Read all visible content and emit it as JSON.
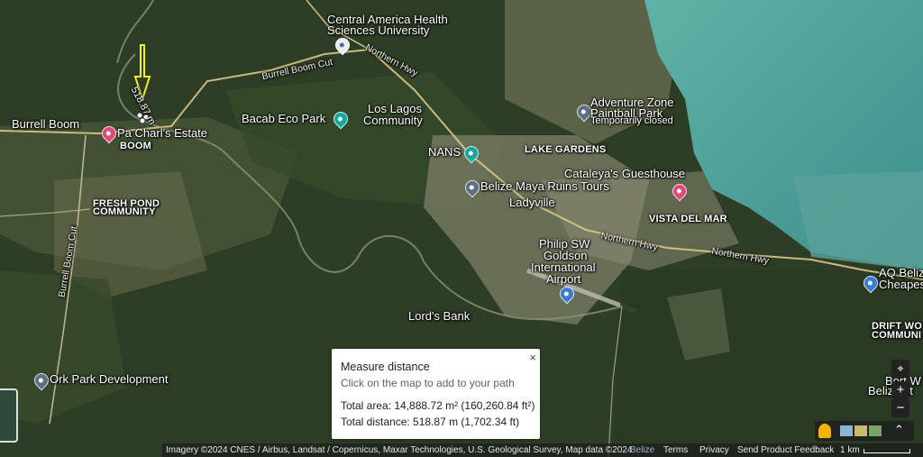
{
  "map": {
    "places": {
      "central_america_line1": "Central America Health",
      "central_america_line2": "Sciences University",
      "burrell_boom": "Burrell Boom",
      "pa_charls": "Pa Charl's Estate",
      "boom": "BOOM",
      "bacab": "Bacab Eco Park",
      "los_lagos_line1": "Los Lagos",
      "los_lagos_line2": "Community",
      "nans": "NANS",
      "adventure_line1": "Adventure Zone",
      "adventure_line2": "Paintball Park",
      "adventure_status": "Temporarily closed",
      "lake_gardens": "LAKE GARDENS",
      "cataleya": "Cataleya's Guesthouse",
      "belize_maya": "Belize Maya Ruins Tours",
      "ladyville": "Ladyville",
      "vista_del_mar": "VISTA DEL MAR",
      "fresh_pond_line1": "FRESH POND",
      "fresh_pond_line2": "COMMUNITY",
      "airport_line1": "Philip SW",
      "airport_line2": "Goldson",
      "airport_line3": "International",
      "airport_line4": "Airport",
      "lords_bank": "Lord's Bank",
      "ork_park": "Ork Park Development",
      "aq_line1": "AQ Beliz",
      "aq_line2": "Cheapes",
      "drift_line1": "DRIFT WO",
      "drift_line2": "COMMUNI",
      "belize_bilt": "Beliz Bilt",
      "bort_w": "Bort W"
    },
    "roads": {
      "burrell_boom_cut_top": "Burrell Boom Cut",
      "northern_hwy_top": "Northern Hwy",
      "northern_hwy_mid": "Northern Hwy",
      "northern_hwy_right": "Northern Hwy",
      "burrell_boom_cut_left": "Burrell Boom Cut"
    },
    "measure_line_label": "518.87 m"
  },
  "measure": {
    "title": "Measure distance",
    "hint": "Click on the map to add to your path",
    "area": "Total area: 14,888.72 m² (160,260.84 ft²)",
    "distance": "Total distance: 518.87 m (1,702.34 ft)",
    "close": "×"
  },
  "footer": {
    "imagery": "Imagery ©2024 CNES / Airbus, Landsat / Copernicus, Maxar Technologies, U.S. Geological Survey, Map data ©2024",
    "region": "Belize",
    "terms": "Terms",
    "privacy": "Privacy",
    "feedback": "Send Product Feedback",
    "scale": "1 km"
  },
  "controls": {
    "zoom_in": "+",
    "zoom_out": "−",
    "locate_icon": "crosshair-icon",
    "pegman_icon": "pegman-icon",
    "expand_icon": "chevron-up-icon"
  },
  "colors": {
    "sea": "#4a9e97",
    "forest": "#2e3d25",
    "arrow": "#f5ef2a"
  }
}
